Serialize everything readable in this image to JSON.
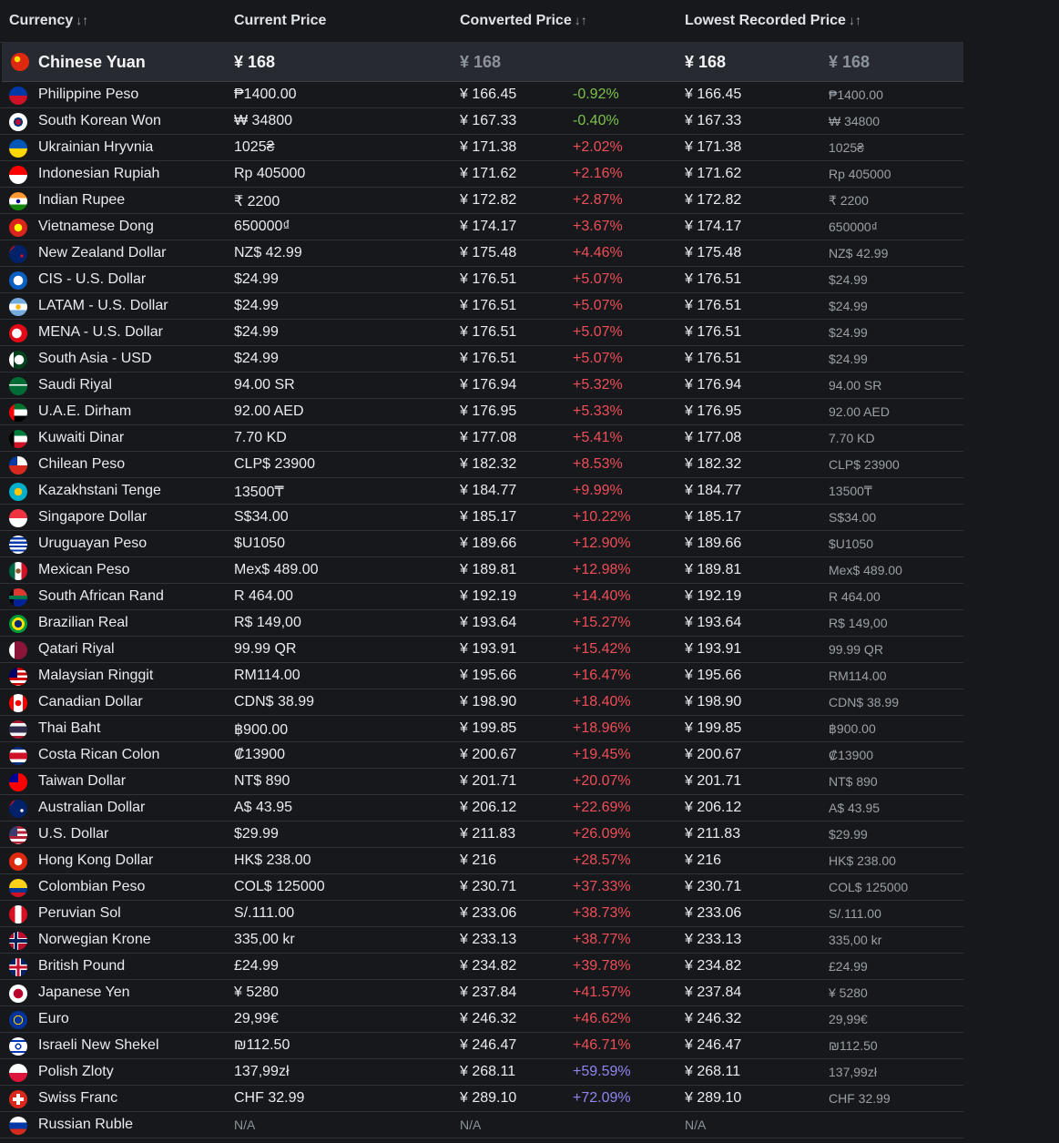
{
  "headers": {
    "currency": "Currency",
    "current_price": "Current Price",
    "converted_price": "Converted Price",
    "lowest_recorded": "Lowest Recorded Price",
    "sort_glyph": "↓↑"
  },
  "base": {
    "flag": "cn",
    "name": "Chinese Yuan",
    "current": "¥ 168",
    "converted": "¥ 168",
    "lowest": "¥ 168",
    "lowest_orig": "¥ 168"
  },
  "rows": [
    {
      "flag": "ph",
      "name": "Philippine Peso",
      "current": "₱1400.00",
      "converted": "¥ 166.45",
      "pct": "-0.92%",
      "lowest": "¥ 166.45",
      "lowest_orig": "₱1400.00"
    },
    {
      "flag": "kr",
      "name": "South Korean Won",
      "current": "₩ 34800",
      "converted": "¥ 167.33",
      "pct": "-0.40%",
      "lowest": "¥ 167.33",
      "lowest_orig": "₩ 34800"
    },
    {
      "flag": "ua",
      "name": "Ukrainian Hryvnia",
      "current": "1025₴",
      "converted": "¥ 171.38",
      "pct": "+2.02%",
      "lowest": "¥ 171.38",
      "lowest_orig": "1025₴"
    },
    {
      "flag": "id",
      "name": "Indonesian Rupiah",
      "current": "Rp 405000",
      "converted": "¥ 171.62",
      "pct": "+2.16%",
      "lowest": "¥ 171.62",
      "lowest_orig": "Rp 405000"
    },
    {
      "flag": "in",
      "name": "Indian Rupee",
      "current": "₹ 2200",
      "converted": "¥ 172.82",
      "pct": "+2.87%",
      "lowest": "¥ 172.82",
      "lowest_orig": "₹ 2200"
    },
    {
      "flag": "vn",
      "name": "Vietnamese Dong",
      "current": "650000₫",
      "converted": "¥ 174.17",
      "pct": "+3.67%",
      "lowest": "¥ 174.17",
      "lowest_orig": "650000₫"
    },
    {
      "flag": "nz",
      "name": "New Zealand Dollar",
      "current": "NZ$ 42.99",
      "converted": "¥ 175.48",
      "pct": "+4.46%",
      "lowest": "¥ 175.48",
      "lowest_orig": "NZ$ 42.99"
    },
    {
      "flag": "cis",
      "name": "CIS - U.S. Dollar",
      "current": "$24.99",
      "converted": "¥ 176.51",
      "pct": "+5.07%",
      "lowest": "¥ 176.51",
      "lowest_orig": "$24.99"
    },
    {
      "flag": "latam",
      "name": "LATAM - U.S. Dollar",
      "current": "$24.99",
      "converted": "¥ 176.51",
      "pct": "+5.07%",
      "lowest": "¥ 176.51",
      "lowest_orig": "$24.99"
    },
    {
      "flag": "mena",
      "name": "MENA - U.S. Dollar",
      "current": "$24.99",
      "converted": "¥ 176.51",
      "pct": "+5.07%",
      "lowest": "¥ 176.51",
      "lowest_orig": "$24.99"
    },
    {
      "flag": "sasia",
      "name": "South Asia - USD",
      "current": "$24.99",
      "converted": "¥ 176.51",
      "pct": "+5.07%",
      "lowest": "¥ 176.51",
      "lowest_orig": "$24.99"
    },
    {
      "flag": "sa",
      "name": "Saudi Riyal",
      "current": "94.00 SR",
      "converted": "¥ 176.94",
      "pct": "+5.32%",
      "lowest": "¥ 176.94",
      "lowest_orig": "94.00 SR"
    },
    {
      "flag": "ae",
      "name": "U.A.E. Dirham",
      "current": "92.00 AED",
      "converted": "¥ 176.95",
      "pct": "+5.33%",
      "lowest": "¥ 176.95",
      "lowest_orig": "92.00 AED"
    },
    {
      "flag": "kw",
      "name": "Kuwaiti Dinar",
      "current": "7.70 KD",
      "converted": "¥ 177.08",
      "pct": "+5.41%",
      "lowest": "¥ 177.08",
      "lowest_orig": "7.70 KD"
    },
    {
      "flag": "cl",
      "name": "Chilean Peso",
      "current": "CLP$ 23900",
      "converted": "¥ 182.32",
      "pct": "+8.53%",
      "lowest": "¥ 182.32",
      "lowest_orig": "CLP$ 23900"
    },
    {
      "flag": "kz",
      "name": "Kazakhstani Tenge",
      "current": "13500₸",
      "converted": "¥ 184.77",
      "pct": "+9.99%",
      "lowest": "¥ 184.77",
      "lowest_orig": "13500₸"
    },
    {
      "flag": "sg",
      "name": "Singapore Dollar",
      "current": "S$34.00",
      "converted": "¥ 185.17",
      "pct": "+10.22%",
      "lowest": "¥ 185.17",
      "lowest_orig": "S$34.00"
    },
    {
      "flag": "uy",
      "name": "Uruguayan Peso",
      "current": "$U1050",
      "converted": "¥ 189.66",
      "pct": "+12.90%",
      "lowest": "¥ 189.66",
      "lowest_orig": "$U1050"
    },
    {
      "flag": "mx",
      "name": "Mexican Peso",
      "current": "Mex$ 489.00",
      "converted": "¥ 189.81",
      "pct": "+12.98%",
      "lowest": "¥ 189.81",
      "lowest_orig": "Mex$ 489.00"
    },
    {
      "flag": "za",
      "name": "South African Rand",
      "current": "R 464.00",
      "converted": "¥ 192.19",
      "pct": "+14.40%",
      "lowest": "¥ 192.19",
      "lowest_orig": "R 464.00"
    },
    {
      "flag": "br",
      "name": "Brazilian Real",
      "current": "R$ 149,00",
      "converted": "¥ 193.64",
      "pct": "+15.27%",
      "lowest": "¥ 193.64",
      "lowest_orig": "R$ 149,00"
    },
    {
      "flag": "qa",
      "name": "Qatari Riyal",
      "current": "99.99 QR",
      "converted": "¥ 193.91",
      "pct": "+15.42%",
      "lowest": "¥ 193.91",
      "lowest_orig": "99.99 QR"
    },
    {
      "flag": "my",
      "name": "Malaysian Ringgit",
      "current": "RM114.00",
      "converted": "¥ 195.66",
      "pct": "+16.47%",
      "lowest": "¥ 195.66",
      "lowest_orig": "RM114.00"
    },
    {
      "flag": "ca",
      "name": "Canadian Dollar",
      "current": "CDN$ 38.99",
      "converted": "¥ 198.90",
      "pct": "+18.40%",
      "lowest": "¥ 198.90",
      "lowest_orig": "CDN$ 38.99"
    },
    {
      "flag": "th",
      "name": "Thai Baht",
      "current": "฿900.00",
      "converted": "¥ 199.85",
      "pct": "+18.96%",
      "lowest": "¥ 199.85",
      "lowest_orig": "฿900.00"
    },
    {
      "flag": "cr",
      "name": "Costa Rican Colon",
      "current": "₡13900",
      "converted": "¥ 200.67",
      "pct": "+19.45%",
      "lowest": "¥ 200.67",
      "lowest_orig": "₡13900"
    },
    {
      "flag": "tw",
      "name": "Taiwan Dollar",
      "current": "NT$ 890",
      "converted": "¥ 201.71",
      "pct": "+20.07%",
      "lowest": "¥ 201.71",
      "lowest_orig": "NT$ 890"
    },
    {
      "flag": "au",
      "name": "Australian Dollar",
      "current": "A$ 43.95",
      "converted": "¥ 206.12",
      "pct": "+22.69%",
      "lowest": "¥ 206.12",
      "lowest_orig": "A$ 43.95"
    },
    {
      "flag": "us",
      "name": "U.S. Dollar",
      "current": "$29.99",
      "converted": "¥ 211.83",
      "pct": "+26.09%",
      "lowest": "¥ 211.83",
      "lowest_orig": "$29.99"
    },
    {
      "flag": "hk",
      "name": "Hong Kong Dollar",
      "current": "HK$ 238.00",
      "converted": "¥ 216",
      "pct": "+28.57%",
      "lowest": "¥ 216",
      "lowest_orig": "HK$ 238.00"
    },
    {
      "flag": "co",
      "name": "Colombian Peso",
      "current": "COL$ 125000",
      "converted": "¥ 230.71",
      "pct": "+37.33%",
      "lowest": "¥ 230.71",
      "lowest_orig": "COL$ 125000"
    },
    {
      "flag": "pe",
      "name": "Peruvian Sol",
      "current": "S/.111.00",
      "converted": "¥ 233.06",
      "pct": "+38.73%",
      "lowest": "¥ 233.06",
      "lowest_orig": "S/.111.00"
    },
    {
      "flag": "no",
      "name": "Norwegian Krone",
      "current": "335,00 kr",
      "converted": "¥ 233.13",
      "pct": "+38.77%",
      "lowest": "¥ 233.13",
      "lowest_orig": "335,00 kr"
    },
    {
      "flag": "gb",
      "name": "British Pound",
      "current": "£24.99",
      "converted": "¥ 234.82",
      "pct": "+39.78%",
      "lowest": "¥ 234.82",
      "lowest_orig": "£24.99"
    },
    {
      "flag": "jp",
      "name": "Japanese Yen",
      "current": "¥ 5280",
      "converted": "¥ 237.84",
      "pct": "+41.57%",
      "lowest": "¥ 237.84",
      "lowest_orig": "¥ 5280"
    },
    {
      "flag": "eu",
      "name": "Euro",
      "current": "29,99€",
      "converted": "¥ 246.32",
      "pct": "+46.62%",
      "lowest": "¥ 246.32",
      "lowest_orig": "29,99€"
    },
    {
      "flag": "il",
      "name": "Israeli New Shekel",
      "current": "₪112.50",
      "converted": "¥ 246.47",
      "pct": "+46.71%",
      "lowest": "¥ 246.47",
      "lowest_orig": "₪112.50"
    },
    {
      "flag": "pl",
      "name": "Polish Zloty",
      "current": "137,99zł",
      "converted": "¥ 268.11",
      "pct": "+59.59%",
      "lowest": "¥ 268.11",
      "lowest_orig": "137,99zł"
    },
    {
      "flag": "ch",
      "name": "Swiss Franc",
      "current": "CHF 32.99",
      "converted": "¥ 289.10",
      "pct": "+72.09%",
      "lowest": "¥ 289.10",
      "lowest_orig": "CHF 32.99"
    },
    {
      "flag": "ru",
      "name": "Russian Ruble",
      "current": "N/A",
      "converted": "N/A",
      "pct": "",
      "lowest": "N/A",
      "lowest_orig": ""
    }
  ],
  "colors": {
    "negative": "#7cc24a",
    "positive": "#f04e57",
    "high": "#8f86f0"
  }
}
